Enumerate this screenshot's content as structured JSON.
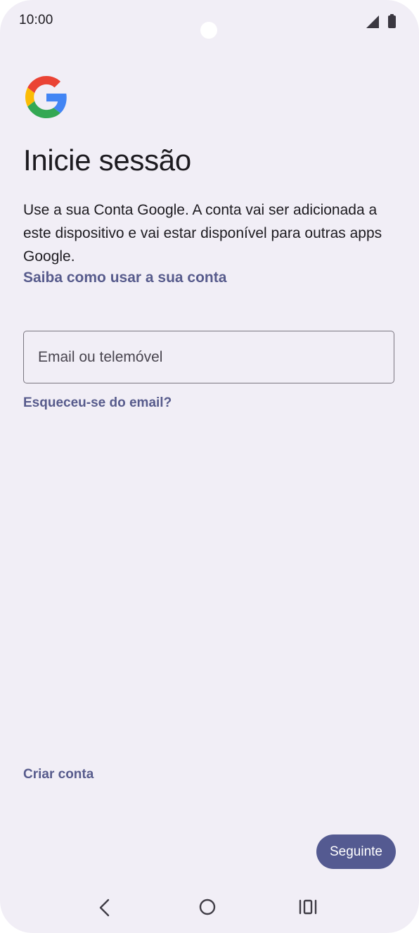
{
  "status_bar": {
    "time": "10:00",
    "icons": [
      "signal-icon",
      "battery-icon"
    ]
  },
  "logo": {
    "icon": "google-logo",
    "colors": {
      "red": "#ea4335",
      "yellow": "#fbbc05",
      "green": "#34a853",
      "blue": "#4285f4"
    }
  },
  "page": {
    "title": "Inicie sessão",
    "description": "Use a sua Conta Google. A conta vai ser adicionada a este dispositivo e vai estar disponível para outras apps Google.",
    "learn_link": "Saiba como usar a sua conta"
  },
  "email_field": {
    "value": "",
    "placeholder": "Email ou telemóvel"
  },
  "forgot_link": "Esqueceu-se do email?",
  "create_account_link": "Criar conta",
  "next_button": "Seguinte",
  "nav_bar": {
    "icons": [
      "back-icon",
      "home-icon",
      "recents-icon"
    ]
  },
  "theme": {
    "background": "#f1eef6",
    "accent": "#545a91",
    "link": "#575b8c",
    "text": "#1d1b20"
  }
}
